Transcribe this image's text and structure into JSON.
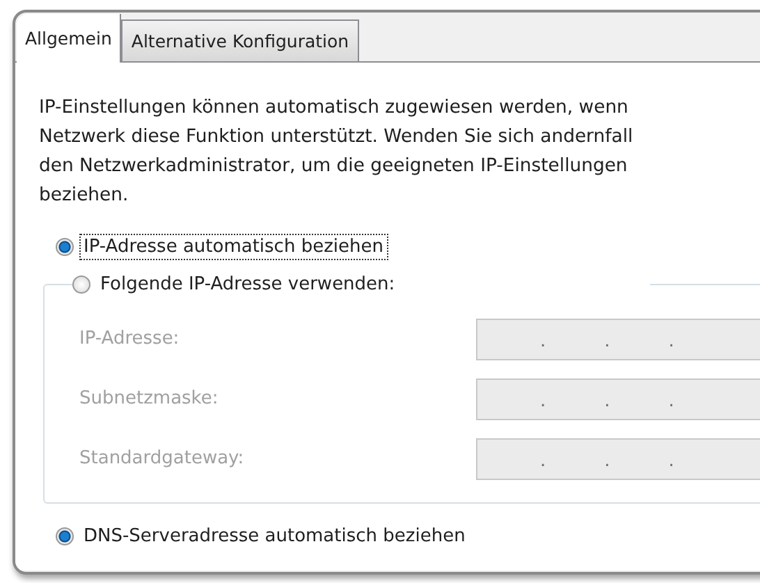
{
  "tabs": [
    {
      "label": "Allgemein",
      "selected": true
    },
    {
      "label": "Alternative Konfiguration",
      "selected": false
    }
  ],
  "description_lines": [
    "IP-Einstellungen können automatisch zugewiesen werden, wenn",
    "Netzwerk diese Funktion unterstützt. Wenden Sie sich andernfall",
    "den Netzwerkadministrator, um die geeigneten IP-Einstellungen",
    "beziehen."
  ],
  "ip_auto_radio": {
    "label": "IP-Adresse automatisch beziehen",
    "selected": true,
    "focused": true
  },
  "ip_manual_group": {
    "radio": {
      "label": "Folgende IP-Adresse verwenden:",
      "selected": false
    },
    "fields": [
      {
        "label": "IP-Adresse:",
        "disabled": true,
        "separators": [
          ".",
          ".",
          "."
        ]
      },
      {
        "label": "Subnetzmaske:",
        "disabled": true,
        "separators": [
          ".",
          ".",
          "."
        ]
      },
      {
        "label": "Standardgateway:",
        "disabled": true,
        "separators": [
          ".",
          ".",
          "."
        ]
      }
    ]
  },
  "dns_auto_radio": {
    "label": "DNS-Serveradresse automatisch beziehen",
    "selected": true
  }
}
